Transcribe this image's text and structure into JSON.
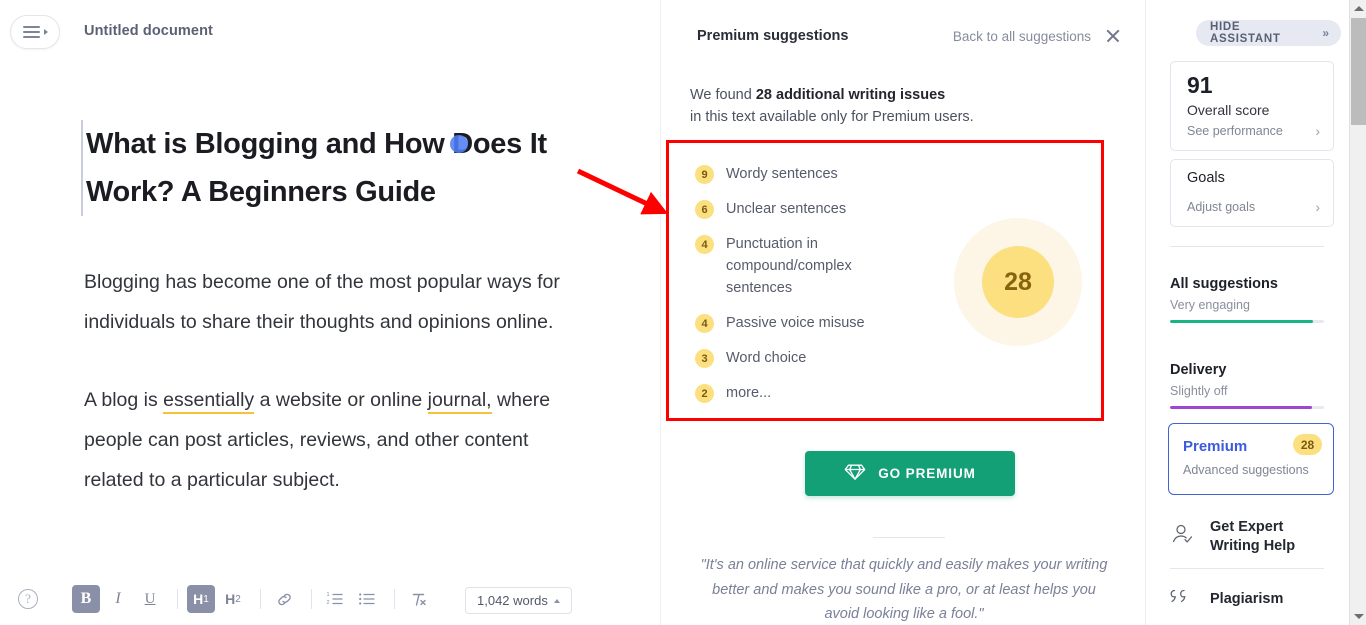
{
  "editor": {
    "menu_icon": "hamburger-menu-icon",
    "doc_title": "Untitled document",
    "heading": "What is Blogging and How Does It Work? A Beginners Guide",
    "paragraph1": "Blogging has become one of the most popular ways for individuals to share their thoughts and opinions online.",
    "paragraph2_pre": "A blog is ",
    "paragraph2_sug1": "essentially",
    "paragraph2_mid": " a website or online ",
    "paragraph2_sug2": "journal,",
    "paragraph2_post": " where people can post articles, reviews, and other content related to a particular subject.",
    "toolbar": {
      "help_label": "?",
      "bold": "B",
      "italic": "I",
      "underline": "U",
      "h1": "H",
      "h1_sub": "1",
      "h2": "H",
      "h2_sub": "2",
      "link": "link-icon",
      "numbered_list": "numbered-list-icon",
      "bullet_list": "bullet-list-icon",
      "clear_format": "clear-formatting-icon",
      "word_count": "1,042 words"
    }
  },
  "premium_panel": {
    "title": "Premium suggestions",
    "back_link": "Back to all suggestions",
    "close_icon": "close-icon",
    "found_prefix": "We found ",
    "found_bold": "28 additional writing issues",
    "found_suffix": "in this text available only for Premium users.",
    "suggestions": [
      {
        "count": "9",
        "label": "Wordy sentences"
      },
      {
        "count": "6",
        "label": "Unclear sentences"
      },
      {
        "count": "4",
        "label": "Punctuation in compound/complex sentences"
      },
      {
        "count": "4",
        "label": "Passive voice misuse"
      },
      {
        "count": "3",
        "label": "Word choice"
      },
      {
        "count": "2",
        "label": "more..."
      }
    ],
    "total": "28",
    "cta_label": "GO PREMIUM",
    "cta_icon": "diamond-icon",
    "quote": "\"It's an online service that quickly and easily makes your writing better and makes you sound like a pro, or at least helps you avoid looking like a fool.\"",
    "highlight_box_color": "#ff0000"
  },
  "sidebar": {
    "hide_assistant": "HIDE ASSISTANT",
    "hide_assistant_icon": "chevron-double-right-icon",
    "score": {
      "value": "91",
      "label": "Overall score",
      "link": "See performance"
    },
    "goals": {
      "title": "Goals",
      "link": "Adjust goals"
    },
    "meters": [
      {
        "title": "All suggestions",
        "sub": "Very engaging",
        "percent": 93,
        "color": "#17b583"
      },
      {
        "title": "Delivery",
        "sub": "Slightly off",
        "percent": 92,
        "color": "#9b46d4"
      }
    ],
    "premium": {
      "title": "Premium",
      "sub": "Advanced suggestions",
      "badge": "28",
      "accent": "#3b5bdb"
    },
    "links": [
      {
        "label": "Get Expert Writing Help",
        "icon": "person-check-icon"
      },
      {
        "label": "Plagiarism",
        "icon": "quotation-marks-icon"
      }
    ]
  }
}
